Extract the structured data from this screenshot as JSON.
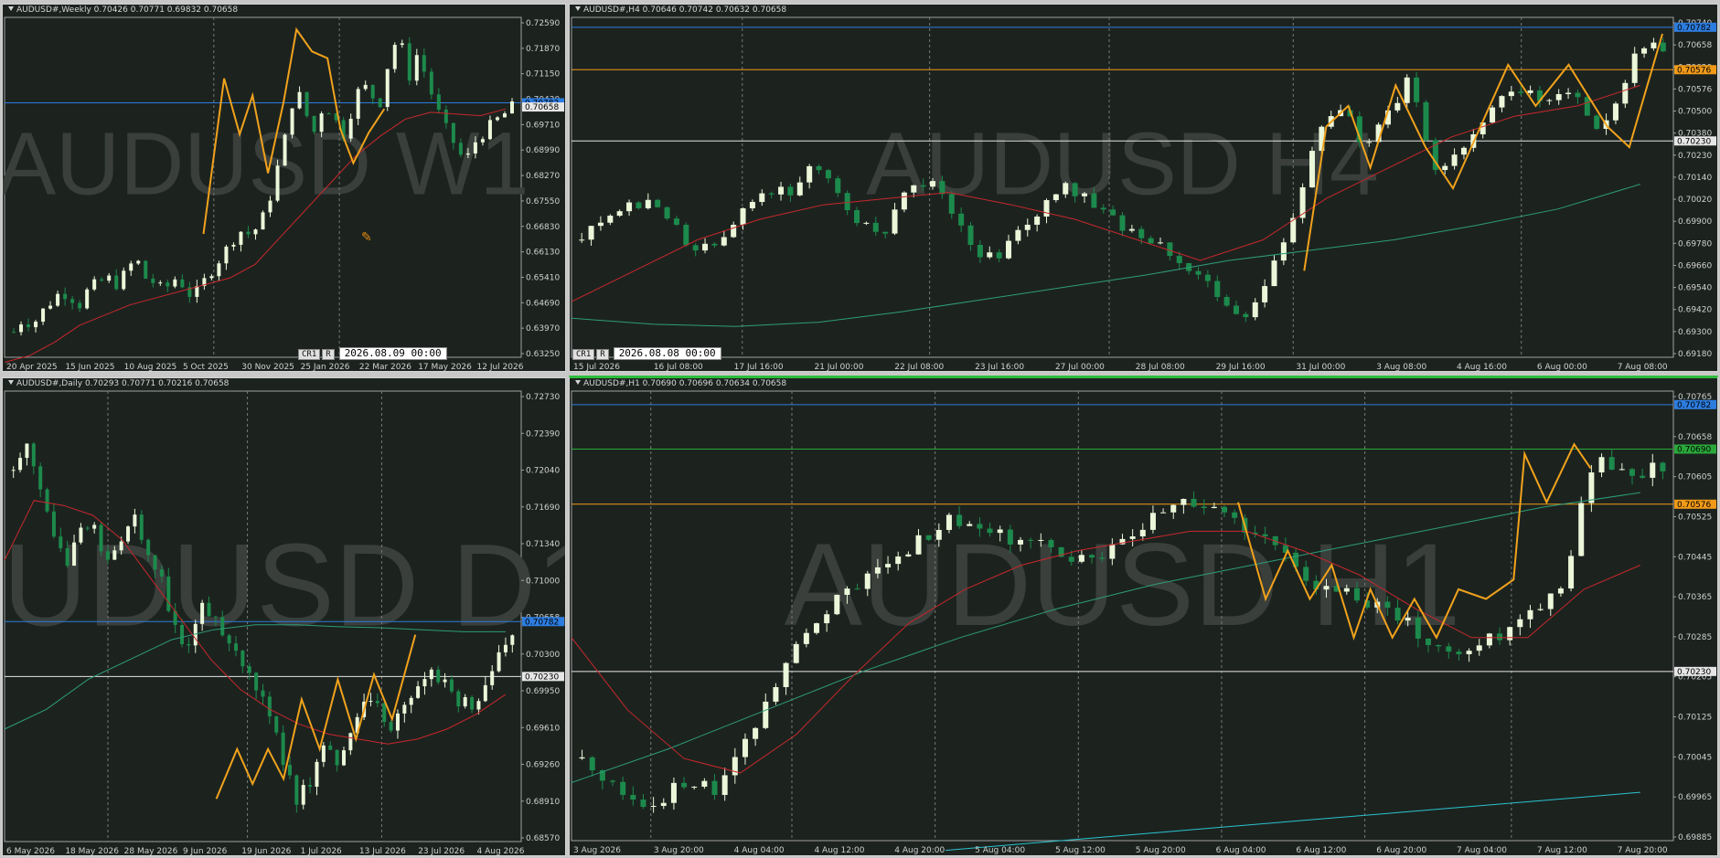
{
  "colors": {
    "background": "#1c231f",
    "bull": "#eaf7d9",
    "bear": "#1c8a4c",
    "zigzag": "#f1a21c",
    "ma_fast": "#c8272b",
    "ma_slow": "#2e9c7a",
    "ma_slow_h1": "#2bc3cf",
    "line_blue": "#2d7de0",
    "line_orange": "#f09a18",
    "line_white": "#e6e6e6",
    "line_green": "#2aa83a",
    "watermark": "#3a3f3c"
  },
  "panels": [
    {
      "id": "w1",
      "title": "AUDUSD#,Weekly  0.70426 0.70771 0.69832 0.70658",
      "watermark": "AUDUSD W1",
      "show_controls": true,
      "controls": {
        "btn1": "CR1",
        "btn2": "R",
        "time": "2026.08.09 00:00"
      },
      "cursor_icon": "pencil-cursor-icon",
      "chart_data": {
        "type": "candlestick",
        "ylim": [
          0.6325,
          0.7331
        ],
        "y_ticks": [
          "0.72590",
          "0.71870",
          "0.71150",
          "0.70430",
          "0.69710",
          "0.68990",
          "0.68270",
          "0.67550",
          "0.66830",
          "0.66130",
          "0.65410",
          "0.64690",
          "0.63970",
          "0.63250"
        ],
        "x_labels": [
          "20 Apr 2025",
          "15 Jun 2025",
          "10 Aug 2025",
          "5 Oct 2025",
          "30 Nov 2025",
          "25 Jan 2026",
          "22 Mar 2026",
          "17 May 2026",
          "12 Jul 2026"
        ],
        "candles": 69,
        "close_path": [
          0.64,
          0.644,
          0.642,
          0.646,
          0.649,
          0.652,
          0.6505,
          0.648,
          0.653,
          0.6545,
          0.656,
          0.654,
          0.658,
          0.662,
          0.656,
          0.6545,
          0.652,
          0.656,
          0.654,
          0.65,
          0.654,
          0.658,
          0.662,
          0.666,
          0.67,
          0.669,
          0.671,
          0.677,
          0.688,
          0.699,
          0.713,
          0.705,
          0.699,
          0.708,
          0.704,
          0.698,
          0.706,
          0.714,
          0.71,
          0.708,
          0.722,
          0.728,
          0.715,
          0.723,
          0.714,
          0.706,
          0.7,
          0.695,
          0.69,
          0.696,
          0.699,
          0.702,
          0.704,
          0.7066
        ],
        "ma_fast_path": [
          0.631,
          0.633,
          0.637,
          0.642,
          0.645,
          0.648,
          0.65,
          0.652,
          0.654,
          0.656,
          0.66,
          0.668,
          0.676,
          0.684,
          0.692,
          0.698,
          0.703,
          0.705,
          0.7045,
          0.704,
          0.706
        ],
        "zigzag": [
          [
            0.385,
            0.669
          ],
          [
            0.425,
            0.715
          ],
          [
            0.455,
            0.6985
          ],
          [
            0.48,
            0.71
          ],
          [
            0.51,
            0.687
          ],
          [
            0.54,
            0.708
          ],
          [
            0.565,
            0.7295
          ],
          [
            0.595,
            0.723
          ],
          [
            0.625,
            0.721
          ],
          [
            0.65,
            0.7
          ],
          [
            0.675,
            0.69
          ],
          [
            0.705,
            0.699
          ],
          [
            0.735,
            0.706
          ]
        ],
        "price_lines": [
          {
            "value": 0.70782,
            "color": "line_blue",
            "label": "0.70782"
          },
          {
            "value": 0.70658,
            "color": "none",
            "label": "0.70658"
          }
        ],
        "period_separators": [
          0.405,
          0.648
        ]
      }
    },
    {
      "id": "h4",
      "title": "AUDUSD#,H4  0.70646 0.70742 0.70632 0.70658",
      "watermark": "AUDUSD H4",
      "show_controls": true,
      "controls": {
        "btn1": "CR1",
        "btn2": "R",
        "time": "2026.08.08 00:00"
      },
      "chart_data": {
        "type": "candlestick",
        "ylim": [
          0.6918,
          0.7083
        ],
        "y_ticks": [
          "0.70740",
          "0.70658",
          "0.70620",
          "0.70576",
          "0.70500",
          "0.70380",
          "0.70230",
          "0.70140",
          "0.70020",
          "0.69900",
          "0.69780",
          "0.69660",
          "0.69540",
          "0.69420",
          "0.69300",
          "0.69180"
        ],
        "x_labels": [
          "15 Jul 2026",
          "16 Jul 08:00",
          "17 Jul 16:00",
          "21 Jul 00:00",
          "22 Jul 08:00",
          "23 Jul 16:00",
          "27 Jul 00:00",
          "28 Jul 08:00",
          "29 Jul 16:00",
          "31 Jul 00:00",
          "3 Aug 08:00",
          "4 Aug 16:00",
          "6 Aug 00:00",
          "7 Aug 08:00"
        ],
        "candles": 115,
        "close_path": [
          0.6975,
          0.6985,
          0.699,
          0.6995,
          0.6982,
          0.6968,
          0.6975,
          0.6992,
          0.7,
          0.6998,
          0.7012,
          0.7,
          0.6985,
          0.6975,
          0.6995,
          0.7005,
          0.699,
          0.697,
          0.6965,
          0.698,
          0.699,
          0.7,
          0.6995,
          0.6985,
          0.6978,
          0.6975,
          0.6965,
          0.6955,
          0.6945,
          0.6935,
          0.696,
          0.699,
          0.703,
          0.704,
          0.702,
          0.7035,
          0.7055,
          0.701,
          0.7015,
          0.703,
          0.7045,
          0.705,
          0.704,
          0.705,
          0.703,
          0.704,
          0.707,
          0.7068
        ],
        "ma_fast_path": [
          0.6945,
          0.696,
          0.6975,
          0.6985,
          0.6992,
          0.6995,
          0.6998,
          0.6992,
          0.6985,
          0.6975,
          0.6965,
          0.6975,
          0.6995,
          0.701,
          0.7025,
          0.7035,
          0.704,
          0.705
        ],
        "ma_slow_path": [
          0.6937,
          0.6934,
          0.6933,
          0.6935,
          0.694,
          0.6946,
          0.6952,
          0.6958,
          0.6965,
          0.697,
          0.6975,
          0.6982,
          0.699,
          0.7002
        ],
        "zigzag": [
          [
            0.665,
            0.696
          ],
          [
            0.685,
            0.703
          ],
          [
            0.705,
            0.704
          ],
          [
            0.725,
            0.701
          ],
          [
            0.748,
            0.705
          ],
          [
            0.775,
            0.702
          ],
          [
            0.8,
            0.7
          ],
          [
            0.825,
            0.703
          ],
          [
            0.85,
            0.706
          ],
          [
            0.875,
            0.704
          ],
          [
            0.905,
            0.706
          ],
          [
            0.94,
            0.703
          ],
          [
            0.96,
            0.702
          ],
          [
            0.99,
            0.7075
          ]
        ],
        "price_lines": [
          {
            "value": 0.70782,
            "color": "line_blue",
            "label": "0.70782"
          },
          {
            "value": 0.70576,
            "color": "line_orange",
            "label": "0.70576"
          },
          {
            "value": 0.7023,
            "color": "line_white",
            "label": "0.70230"
          }
        ],
        "period_separators": [
          0.155,
          0.325,
          0.488,
          0.655,
          0.862
        ]
      }
    },
    {
      "id": "d1",
      "title": "AUDUSD#,Daily  0.70293 0.70771 0.70216 0.70658",
      "watermark": "AUDUSD D1",
      "show_controls": false,
      "chart_data": {
        "type": "candlestick",
        "ylim": [
          0.6857,
          0.731
        ],
        "y_ticks": [
          "0.72730",
          "0.72390",
          "0.72040",
          "0.71690",
          "0.71340",
          "0.71000",
          "0.70658",
          "0.70300",
          "0.69950",
          "0.69610",
          "0.69260",
          "0.68910",
          "0.68570"
        ],
        "x_labels": [
          "6 May 2026",
          "18 May 2026",
          "28 May 2026",
          "9 Jun 2026",
          "19 Jun 2026",
          "1 Jul 2026",
          "13 Jul 2026",
          "23 Jul 2026",
          "4 Aug 2026"
        ],
        "candles": 75,
        "close_path": [
          0.723,
          0.725,
          0.721,
          0.716,
          0.713,
          0.718,
          0.717,
          0.714,
          0.716,
          0.718,
          0.715,
          0.712,
          0.707,
          0.705,
          0.709,
          0.708,
          0.706,
          0.704,
          0.701,
          0.698,
          0.694,
          0.69,
          0.692,
          0.696,
          0.693,
          0.697,
          0.699,
          0.7,
          0.697,
          0.699,
          0.701,
          0.703,
          0.702,
          0.7,
          0.699,
          0.702,
          0.705,
          0.7066
        ],
        "ma_fast_path": [
          0.714,
          0.72,
          0.7195,
          0.7185,
          0.716,
          0.712,
          0.708,
          0.704,
          0.701,
          0.699,
          0.6975,
          0.6965,
          0.696,
          0.6955,
          0.696,
          0.697,
          0.6985,
          0.7005
        ],
        "ma_slow_path": [
          0.697,
          0.699,
          0.702,
          0.704,
          0.706,
          0.707,
          0.7075,
          0.7075,
          0.7073,
          0.7072,
          0.707,
          0.7068,
          0.7068
        ],
        "zigzag": [
          [
            0.41,
            0.69
          ],
          [
            0.45,
            0.695
          ],
          [
            0.48,
            0.6915
          ],
          [
            0.51,
            0.695
          ],
          [
            0.54,
            0.692
          ],
          [
            0.575,
            0.7
          ],
          [
            0.61,
            0.695
          ],
          [
            0.645,
            0.702
          ],
          [
            0.68,
            0.696
          ],
          [
            0.715,
            0.7025
          ],
          [
            0.75,
            0.698
          ],
          [
            0.795,
            0.7065
          ]
        ],
        "price_lines": [
          {
            "value": 0.70782,
            "color": "line_blue",
            "label": "0.70782"
          },
          {
            "value": 0.7023,
            "color": "line_white",
            "label": "0.70230"
          }
        ],
        "period_separators": [
          0.2,
          0.47,
          0.73
        ]
      }
    },
    {
      "id": "h1",
      "title": "AUDUSD#,H1  0.70690 0.70696 0.70634 0.70658",
      "watermark": "AUDUSD H1",
      "active": true,
      "show_controls": false,
      "chart_data": {
        "type": "candlestick",
        "ylim": [
          0.6988,
          0.7081
        ],
        "y_ticks": [
          "0.70765",
          "0.70658",
          "0.70605",
          "0.70525",
          "0.70445",
          "0.70365",
          "0.70285",
          "0.70205",
          "0.70125",
          "0.70045",
          "0.69965",
          "0.69885"
        ],
        "x_labels": [
          "3 Aug 2026",
          "3 Aug 20:00",
          "4 Aug 04:00",
          "4 Aug 12:00",
          "4 Aug 20:00",
          "5 Aug 04:00",
          "5 Aug 12:00",
          "5 Aug 20:00",
          "6 Aug 04:00",
          "6 Aug 12:00",
          "6 Aug 20:00",
          "7 Aug 04:00",
          "7 Aug 12:00",
          "7 Aug 20:00"
        ],
        "candles": 107,
        "close_path": [
          0.7005,
          0.6998,
          0.6995,
          0.7,
          0.6998,
          0.701,
          0.7025,
          0.7035,
          0.704,
          0.7045,
          0.705,
          0.7055,
          0.7052,
          0.705,
          0.7048,
          0.7045,
          0.705,
          0.7055,
          0.7058,
          0.7055,
          0.7052,
          0.7045,
          0.704,
          0.7038,
          0.7035,
          0.703,
          0.7025,
          0.703,
          0.7035,
          0.704,
          0.7068,
          0.7062,
          0.7066
        ],
        "ma_fast_path": [
          0.703,
          0.7015,
          0.7005,
          0.7002,
          0.701,
          0.7022,
          0.7033,
          0.704,
          0.7045,
          0.7048,
          0.705,
          0.7052,
          0.7052,
          0.7048,
          0.7043,
          0.7036,
          0.703,
          0.703,
          0.704,
          0.7045
        ],
        "ma_slow_path": [
          0.7,
          0.7007,
          0.7015,
          0.7023,
          0.703,
          0.7036,
          0.7041,
          0.7045,
          0.7049,
          0.7053,
          0.7057,
          0.706
        ],
        "ma_slow2_path": [
          0.6986,
          0.6988,
          0.699,
          0.6992,
          0.6994,
          0.6996,
          0.6998
        ],
        "zigzag": [
          [
            0.605,
            0.7058
          ],
          [
            0.63,
            0.7038
          ],
          [
            0.65,
            0.7048
          ],
          [
            0.67,
            0.7038
          ],
          [
            0.69,
            0.7045
          ],
          [
            0.71,
            0.703
          ],
          [
            0.725,
            0.704
          ],
          [
            0.745,
            0.703
          ],
          [
            0.765,
            0.7038
          ],
          [
            0.785,
            0.703
          ],
          [
            0.805,
            0.704
          ],
          [
            0.83,
            0.7038
          ],
          [
            0.855,
            0.7042
          ],
          [
            0.865,
            0.7068
          ],
          [
            0.885,
            0.7058
          ],
          [
            0.91,
            0.707
          ],
          [
            0.925,
            0.7065
          ]
        ],
        "price_lines": [
          {
            "value": 0.70782,
            "color": "line_blue",
            "label": "0.70782"
          },
          {
            "value": 0.7069,
            "color": "line_green",
            "label": "0.70690"
          },
          {
            "value": 0.70576,
            "color": "line_orange",
            "label": "0.70576"
          },
          {
            "value": 0.7023,
            "color": "line_white",
            "label": "0.70230"
          }
        ],
        "period_separators": [
          0.072,
          0.2,
          0.33,
          0.46,
          0.59,
          0.72,
          0.853
        ]
      }
    }
  ]
}
